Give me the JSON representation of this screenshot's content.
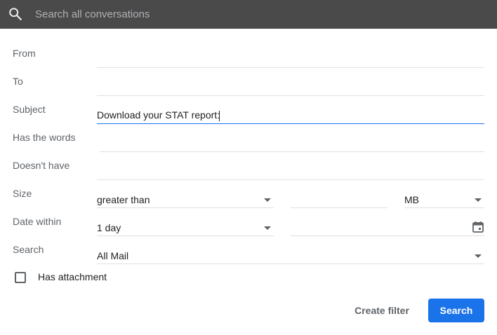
{
  "search": {
    "placeholder": "Search all conversations",
    "icon": "search-icon"
  },
  "fields": {
    "from": {
      "label": "From",
      "value": ""
    },
    "to": {
      "label": "To",
      "value": ""
    },
    "subject": {
      "label": "Subject",
      "value": "Download your STAT report:"
    },
    "has_words": {
      "label": "Has the words",
      "value": ""
    },
    "doesnt_have": {
      "label": "Doesn't have",
      "value": ""
    }
  },
  "size": {
    "label": "Size",
    "operator": "greater than",
    "amount": "",
    "unit": "MB"
  },
  "date_within": {
    "label": "Date within",
    "range": "1 day",
    "date": "",
    "icon": "calendar-icon"
  },
  "search_in": {
    "label": "Search",
    "value": "All Mail"
  },
  "has_attachment": {
    "label": "Has attachment",
    "checked": false
  },
  "buttons": {
    "create_filter": "Create filter",
    "search": "Search"
  },
  "colors": {
    "topbar": "#4a4a4a",
    "accent": "#1a73e8",
    "label": "#5f6368"
  }
}
